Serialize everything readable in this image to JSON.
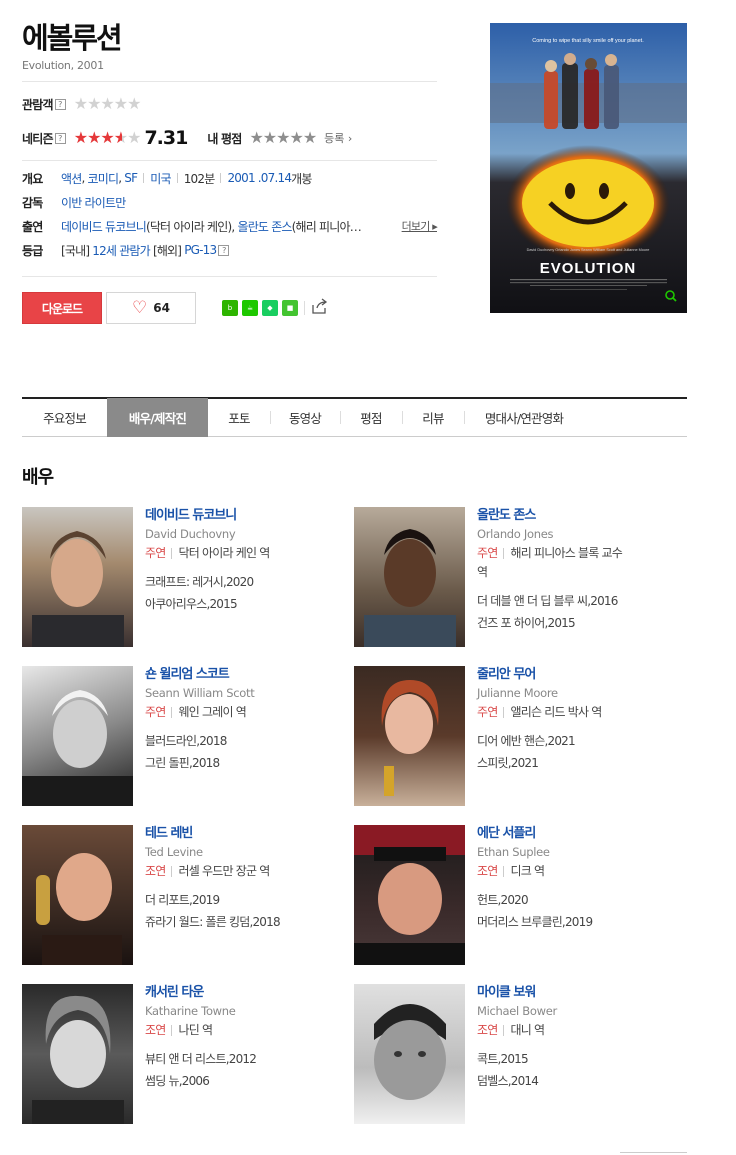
{
  "movie": {
    "title": "에볼루션",
    "subtitle": "Evolution, 2001"
  },
  "ratings": {
    "audience_label": "관람객",
    "netizen_label": "네티즌",
    "netizen_score": "7.31",
    "my_label": "내 평점",
    "register_label": "등록",
    "help": "?"
  },
  "info": {
    "overview_label": "개요",
    "genres": [
      "액션",
      "코미디",
      "SF"
    ],
    "country": "미국",
    "runtime": "102분",
    "release_date": "2001 .07.14",
    "release_suffix": "개봉",
    "director_label": "감독",
    "director": "이반 라이트만",
    "cast_label": "출연",
    "cast_text_1": "데이비드 듀코브니",
    "cast_role_1": "(닥터 아이라 케인),",
    "cast_text_2": "올란도 존스",
    "cast_role_2": "(해리 피니아…",
    "more_label": "더보기",
    "grade_label": "등급",
    "grade_prefix": "[국내]",
    "grade_kr": "12세 관람가",
    "grade_mid": "[해외]",
    "grade_intl": "PG-13"
  },
  "actions": {
    "download_label": "다운로드",
    "like_count": "64"
  },
  "poster": {
    "tagline": "Coming to wipe that silly smile off your planet.",
    "logo": "EVOLUTION",
    "credits": "David Duchovny   Orlando Jones   Seann William Scott   and Julianne Moore"
  },
  "tabs": [
    {
      "label": "주요정보"
    },
    {
      "label": "배우/제작진"
    },
    {
      "label": "포토"
    },
    {
      "label": "동영상"
    },
    {
      "label": "평점"
    },
    {
      "label": "리뷰"
    },
    {
      "label": "명대사/연관영화"
    }
  ],
  "section_title": "배우",
  "actors": [
    {
      "name": "데이비드 듀코브니",
      "en": "David Duchovny",
      "type": "주연",
      "role": "닥터 아이라 케인 역",
      "role2": "",
      "works": [
        "크래프트: 레거시,2020",
        "아쿠아리우스,2015"
      ]
    },
    {
      "name": "올란도 존스",
      "en": "Orlando Jones",
      "type": "주연",
      "role": "해리 피니아스 블록 교수",
      "role2": "역",
      "works": [
        "더 데블 앤 더 딥 블루 씨,2016",
        "건즈 포 하이어,2015"
      ]
    },
    {
      "name": "숀 윌리엄 스코트",
      "en": "Seann William Scott",
      "type": "주연",
      "role": "웨인 그레이 역",
      "role2": "",
      "works": [
        "블러드라인,2018",
        "그린 돌핀,2018"
      ]
    },
    {
      "name": "줄리안 무어",
      "en": "Julianne Moore",
      "type": "주연",
      "role": "앨리슨 리드 박사 역",
      "role2": "",
      "works": [
        "디어 에반 핸슨,2021",
        "스피릿,2021"
      ]
    },
    {
      "name": "테드 레빈",
      "en": "Ted Levine",
      "type": "조연",
      "role": "러셀 우드만 장군 역",
      "role2": "",
      "works": [
        "더 리포트,2019",
        "쥬라기 월드: 폴른 킹덤,2018"
      ]
    },
    {
      "name": "에단 서플리",
      "en": "Ethan Suplee",
      "type": "조연",
      "role": "디크 역",
      "role2": "",
      "works": [
        "헌트,2020",
        "머더리스 브루클린,2019"
      ]
    },
    {
      "name": "캐서린 타운",
      "en": "Katharine Towne",
      "type": "조연",
      "role": "나딘 역",
      "role2": "",
      "works": [
        "뷰티 앤 더 리스트,2012",
        "썸딩 뉴,2006"
      ]
    },
    {
      "name": "마이클 보워",
      "en": "Michael Bower",
      "type": "조연",
      "role": "대니 역",
      "role2": "",
      "works": [
        "콕트,2015",
        "덤벨스,2014"
      ]
    }
  ]
}
